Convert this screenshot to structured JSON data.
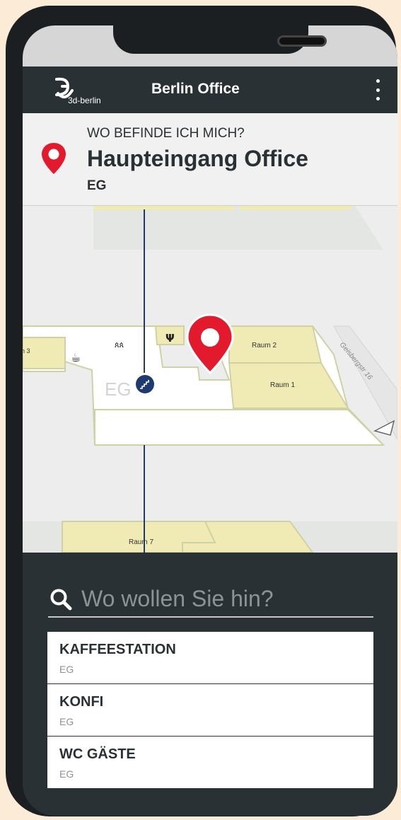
{
  "app": {
    "title": "Berlin Office",
    "logo_text": "3d-berlin"
  },
  "location": {
    "question": "WO BEFINDE ICH MICH?",
    "name": "Haupteingang Office",
    "floor": "EG"
  },
  "map": {
    "floor_label": "EG",
    "rooms": [
      "Raum 2",
      "Raum 1",
      "Raum 7",
      "n 3"
    ],
    "street": "Geisbergstr 16"
  },
  "search": {
    "placeholder": "Wo wollen Sie hin?",
    "value": ""
  },
  "destinations": [
    {
      "name": "KAFFEESTATION",
      "floor": "EG"
    },
    {
      "name": "KONFI",
      "floor": "EG"
    },
    {
      "name": "WC GÄSTE",
      "floor": "EG"
    }
  ],
  "colors": {
    "dark": "#2a3134",
    "accent_red": "#e3192d",
    "room_fill": "#f0eab5",
    "stairs_blue": "#1e3a6e"
  }
}
